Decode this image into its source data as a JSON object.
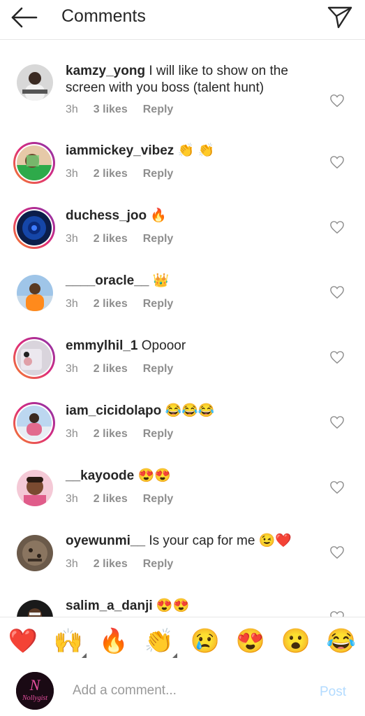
{
  "header": {
    "title": "Comments",
    "back_icon": "arrow-left-icon",
    "send_icon": "paper-plane-icon"
  },
  "comments": [
    {
      "username": "kamzy_yong",
      "text": " I will like to show on the screen with you boss (talent hunt)",
      "time": "3h",
      "likes": "3 likes",
      "reply": "Reply"
    },
    {
      "username": "iammickey_vibez",
      "text": " 👏 👏",
      "time": "3h",
      "likes": "2 likes",
      "reply": "Reply"
    },
    {
      "username": "duchess_joo",
      "text": " 🔥",
      "time": "3h",
      "likes": "2 likes",
      "reply": "Reply"
    },
    {
      "username": "____oracle__",
      "text": "   👑",
      "time": "3h",
      "likes": "2 likes",
      "reply": "Reply"
    },
    {
      "username": "emmylhil_1",
      "text": " Opooor",
      "time": "3h",
      "likes": "2 likes",
      "reply": "Reply"
    },
    {
      "username": "iam_cicidolapo",
      "text": " 😂😂😂",
      "time": "3h",
      "likes": "2 likes",
      "reply": "Reply"
    },
    {
      "username": "__kayoode",
      "text": " 😍😍",
      "time": "3h",
      "likes": "2 likes",
      "reply": "Reply"
    },
    {
      "username": "oyewunmi__",
      "text": " Is your cap for me 😉❤️",
      "time": "3h",
      "likes": "2 likes",
      "reply": "Reply"
    },
    {
      "username": "salim_a_danji",
      "text": " 😍😍",
      "time": "",
      "likes": "",
      "reply": ""
    }
  ],
  "emoji_bar": [
    "❤️",
    "🙌",
    "🔥",
    "👏",
    "😢",
    "😍",
    "😮",
    "😂"
  ],
  "input": {
    "placeholder": "Add a comment...",
    "post_label": "Post",
    "avatar_text": "Nollygist"
  },
  "colors": {
    "post_disabled": "#b3dbff",
    "meta": "#8e8e8e",
    "ring": "#dd2a7b"
  }
}
